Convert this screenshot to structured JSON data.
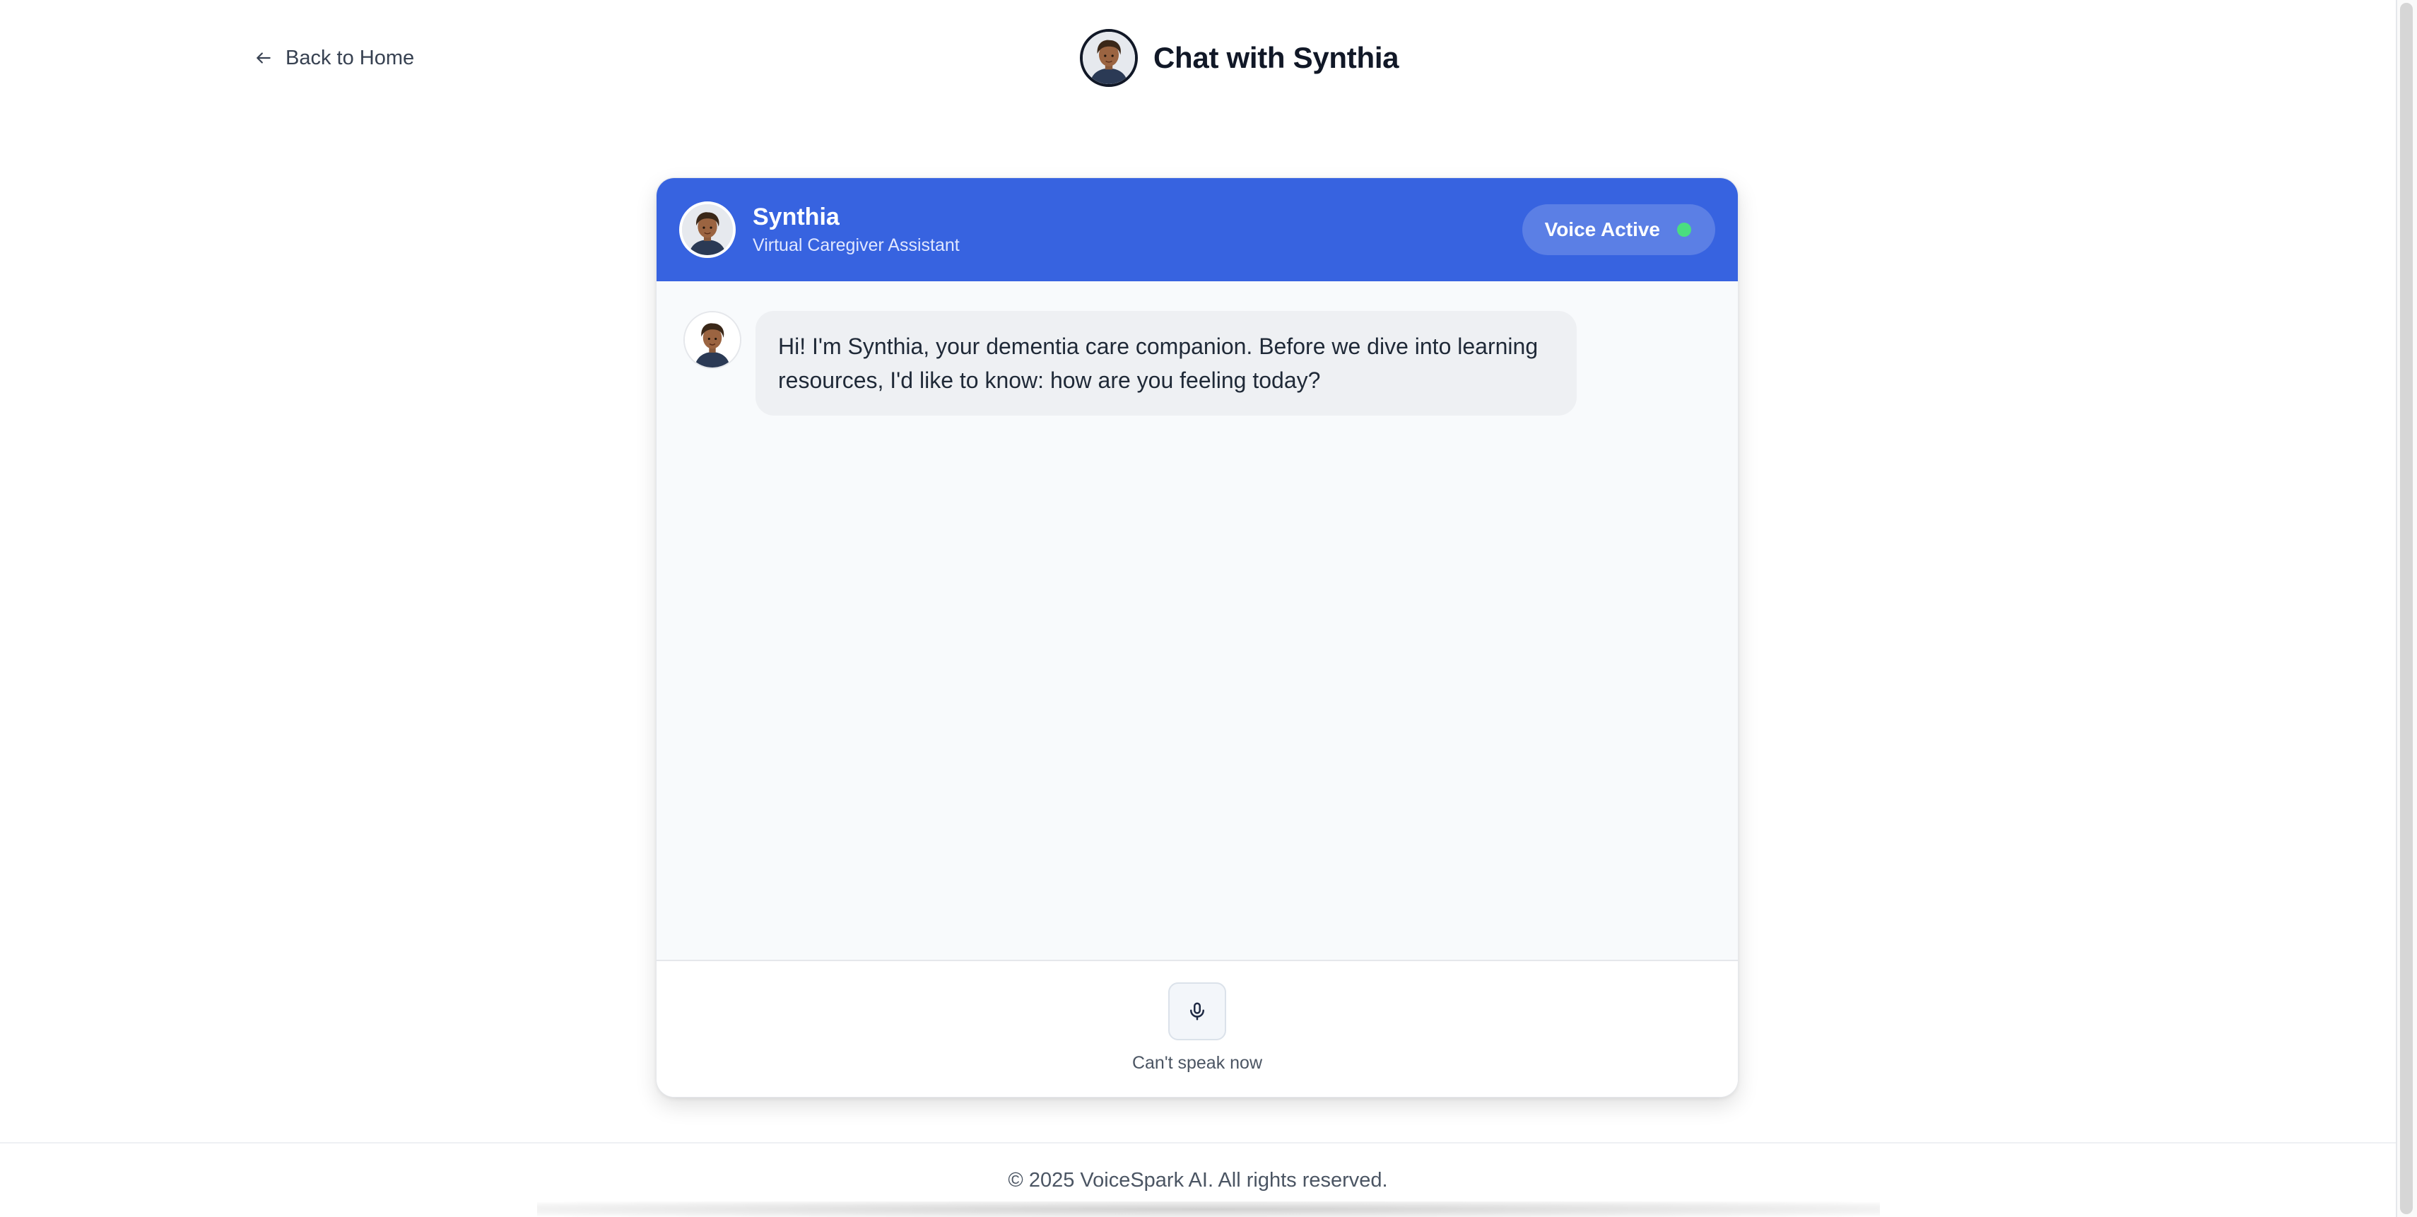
{
  "nav": {
    "back_label": "Back to Home",
    "back_icon": "arrow-left-icon"
  },
  "header": {
    "title": "Chat with Synthia",
    "avatar_icon": "synthia-avatar"
  },
  "chat": {
    "assistant_name": "Synthia",
    "assistant_role": "Virtual Caregiver Assistant",
    "voice_status": "Voice Active",
    "voice_status_color": "#4ade80",
    "header_color": "#3763e0",
    "messages": [
      {
        "sender": "Synthia",
        "text": "Hi! I'm Synthia, your dementia care companion. Before we dive into learning resources, I'd like to know: how are you feeling today?"
      }
    ],
    "mic_icon": "microphone-icon",
    "mic_caption": "Can't speak now"
  },
  "footer": {
    "copyright": "© 2025 VoiceSpark AI. All rights reserved."
  }
}
